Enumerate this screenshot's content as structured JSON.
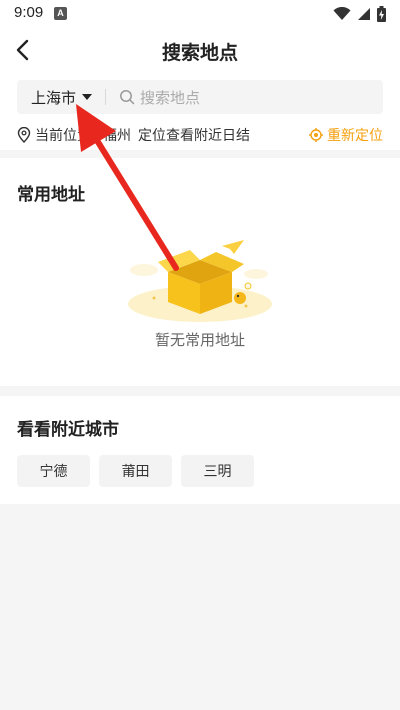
{
  "status_bar": {
    "time": "9:09",
    "notification_badge": "A",
    "icons": [
      "wifi-icon",
      "signal-icon",
      "battery-charging-icon"
    ]
  },
  "nav": {
    "title": "搜索地点",
    "back_icon": "chevron-left-icon"
  },
  "search": {
    "city": "上海市",
    "placeholder": "搜索地点"
  },
  "location": {
    "current_label": "当前位置",
    "current_city": "福州",
    "hint": "定位查看附近日结",
    "relocate_label": "重新定位"
  },
  "common_address": {
    "title": "常用地址",
    "empty_text": "暂无常用地址"
  },
  "nearby": {
    "title": "看看附近城市",
    "cities": [
      "宁德",
      "莆田",
      "三明"
    ]
  },
  "colors": {
    "accent": "#f5a00f",
    "annotation_arrow": "#e8281e",
    "page_background": "#f5f5f5"
  }
}
